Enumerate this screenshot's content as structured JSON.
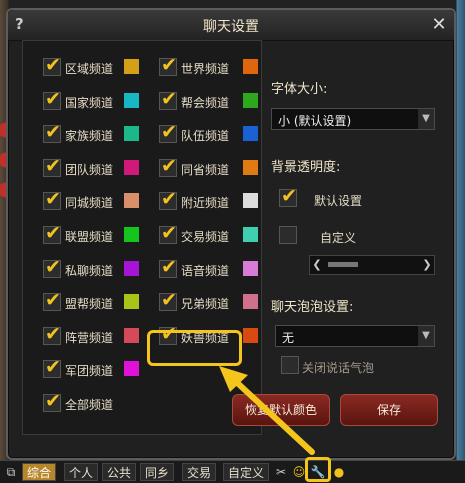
{
  "window": {
    "title": "聊天设置",
    "help": "?",
    "close": "✕"
  },
  "channels_left": [
    {
      "label": "区域频道",
      "color": "#d4a017"
    },
    {
      "label": "国家频道",
      "color": "#17b8c4"
    },
    {
      "label": "家族频道",
      "color": "#1cb88c"
    },
    {
      "label": "团队频道",
      "color": "#d01a7a"
    },
    {
      "label": "同城频道",
      "color": "#d9906a"
    },
    {
      "label": "联盟频道",
      "color": "#16c41e"
    },
    {
      "label": "私聊频道",
      "color": "#a415d6"
    },
    {
      "label": "盟帮频道",
      "color": "#a8c418"
    },
    {
      "label": "阵营频道",
      "color": "#d44a5a"
    },
    {
      "label": "军团频道",
      "color": "#e012d8"
    },
    {
      "label": "全部频道",
      "color": ""
    }
  ],
  "channels_right": [
    {
      "label": "世界频道",
      "color": "#e0660e"
    },
    {
      "label": "帮会频道",
      "color": "#2ea61e"
    },
    {
      "label": "队伍频道",
      "color": "#1a62d4"
    },
    {
      "label": "同省频道",
      "color": "#e07a12"
    },
    {
      "label": "附近频道",
      "color": "#dcdcdc"
    },
    {
      "label": "交易频道",
      "color": "#3ecfb0"
    },
    {
      "label": "语音频道",
      "color": "#d87ad8"
    },
    {
      "label": "兄弟频道",
      "color": "#d0708a"
    },
    {
      "label": "妖兽频道",
      "color": "#d84a12"
    }
  ],
  "font_size": {
    "label": "字体大小:",
    "value": "小 (默认设置)"
  },
  "transparency": {
    "label": "背景透明度:",
    "default_label": "默认设置",
    "custom_label": "自定义"
  },
  "bubble": {
    "label": "聊天泡泡设置:",
    "value": "无",
    "close_label": "关闭说话气泡"
  },
  "buttons": {
    "restore": "恢复默认颜色",
    "save": "保存"
  },
  "bottom_tabs": [
    "综合",
    "个人",
    "公共",
    "同乡",
    "交易",
    "自定义"
  ],
  "icons": {
    "scissors": "scissors-icon",
    "wrench": "wrench-icon",
    "smile": "smile-icon"
  }
}
